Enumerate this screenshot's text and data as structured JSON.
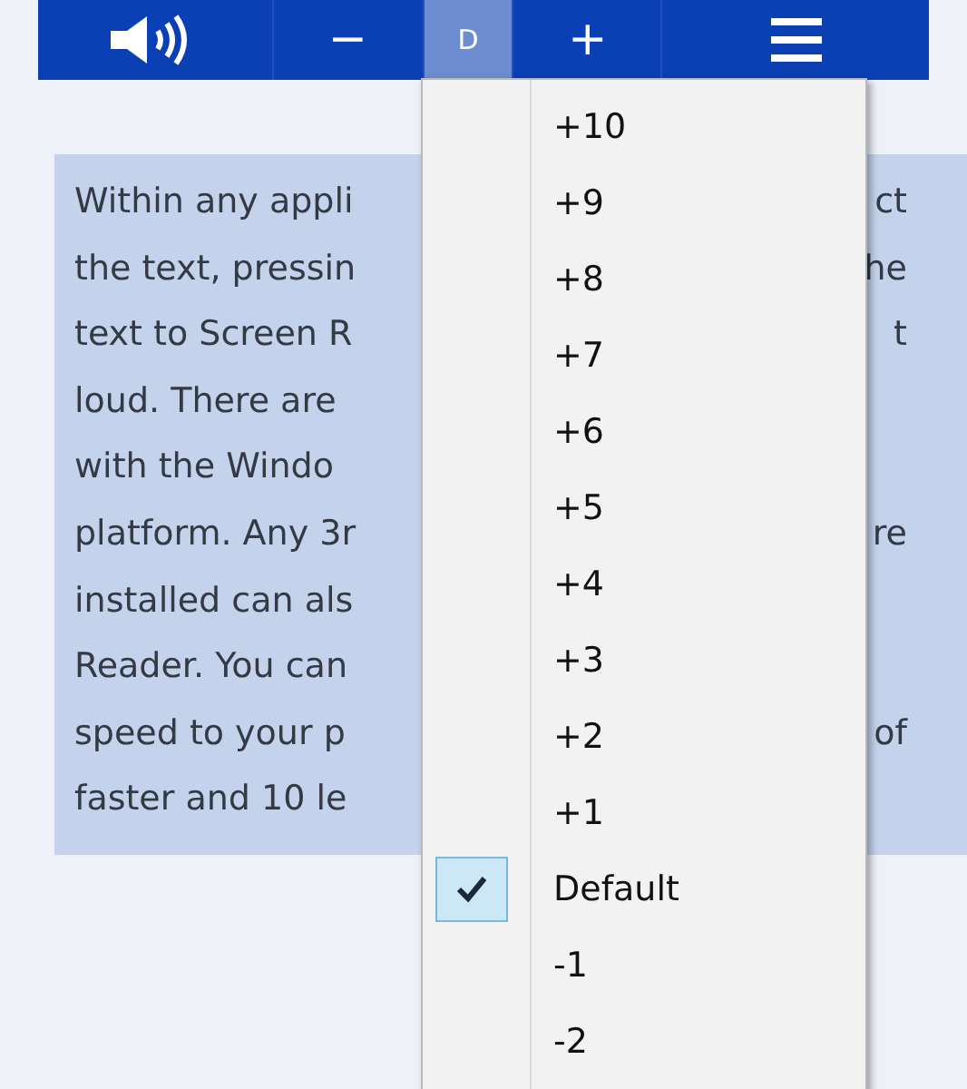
{
  "toolbar": [
    {
      "kind": "speaker",
      "selected": false
    },
    {
      "kind": "text",
      "label": "−",
      "selected": false
    },
    {
      "kind": "text",
      "label": "D",
      "selected": true
    },
    {
      "kind": "text",
      "label": "+",
      "selected": false
    },
    {
      "kind": "menu",
      "selected": false
    }
  ],
  "text_panel": {
    "lines": [
      {
        "left": "Within any appli",
        "right": "ct"
      },
      {
        "left": "the text, pressin",
        "right": "he"
      },
      {
        "left": "text to Screen R",
        "right": "t"
      },
      {
        "left": "loud. There are"
      },
      {
        "left": "with the Windo"
      },
      {
        "left": "platform. Any 3r",
        "right": "re"
      },
      {
        "left": "installed can als"
      },
      {
        "left": "Reader. You can"
      },
      {
        "left": "speed to your p",
        "right": "of"
      },
      {
        "left": "faster and 10 le"
      }
    ]
  },
  "speed_menu": {
    "items": [
      {
        "label": "+10",
        "checked": false
      },
      {
        "label": "+9",
        "checked": false
      },
      {
        "label": "+8",
        "checked": false
      },
      {
        "label": "+7",
        "checked": false
      },
      {
        "label": "+6",
        "checked": false
      },
      {
        "label": "+5",
        "checked": false
      },
      {
        "label": "+4",
        "checked": false
      },
      {
        "label": "+3",
        "checked": false
      },
      {
        "label": "+2",
        "checked": false
      },
      {
        "label": "+1",
        "checked": false
      },
      {
        "label": "Default",
        "checked": true
      },
      {
        "label": "-1",
        "checked": false
      },
      {
        "label": "-2",
        "checked": false
      }
    ]
  }
}
